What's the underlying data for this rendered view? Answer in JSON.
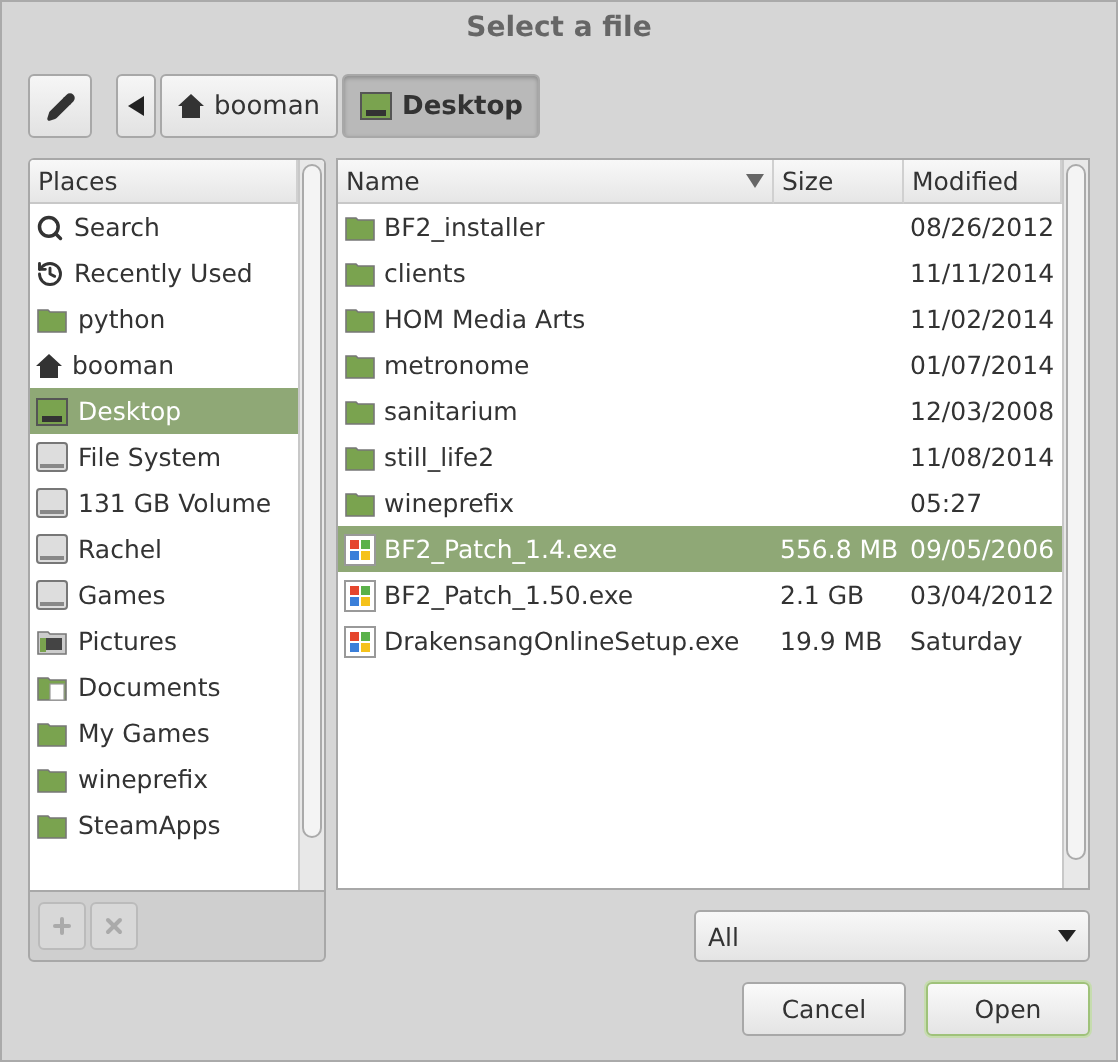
{
  "window": {
    "title": "Select a file"
  },
  "path_bar": {
    "buttons": [
      {
        "label": "booman",
        "kind": "home",
        "selected": false
      },
      {
        "label": "Desktop",
        "kind": "desktop",
        "selected": true
      }
    ]
  },
  "places": {
    "heading": "Places",
    "items": [
      {
        "label": "Search",
        "kind": "search",
        "selected": false
      },
      {
        "label": "Recently Used",
        "kind": "recent",
        "selected": false
      },
      {
        "label": "python",
        "kind": "folder",
        "selected": false
      },
      {
        "label": "booman",
        "kind": "home",
        "selected": false
      },
      {
        "label": "Desktop",
        "kind": "desktop",
        "selected": true
      },
      {
        "label": "File System",
        "kind": "drive",
        "selected": false
      },
      {
        "label": "131 GB Volume",
        "kind": "drive",
        "selected": false
      },
      {
        "label": "Rachel",
        "kind": "drive",
        "selected": false
      },
      {
        "label": "Games",
        "kind": "drive",
        "selected": false
      },
      {
        "label": "Pictures",
        "kind": "pictures",
        "selected": false
      },
      {
        "label": "Documents",
        "kind": "documents",
        "selected": false
      },
      {
        "label": "My Games",
        "kind": "folder",
        "selected": false
      },
      {
        "label": "wineprefix",
        "kind": "folder",
        "selected": false
      },
      {
        "label": "SteamApps",
        "kind": "folder",
        "selected": false
      }
    ]
  },
  "files": {
    "columns": [
      {
        "label": "Name",
        "sorted": true
      },
      {
        "label": "Size",
        "sorted": false
      },
      {
        "label": "Modified",
        "sorted": false
      }
    ],
    "rows": [
      {
        "name": "BF2_installer",
        "size": "",
        "modified": "08/26/2012",
        "kind": "folder",
        "selected": false
      },
      {
        "name": "clients",
        "size": "",
        "modified": "11/11/2014",
        "kind": "folder",
        "selected": false
      },
      {
        "name": "HOM Media Arts",
        "size": "",
        "modified": "11/02/2014",
        "kind": "folder",
        "selected": false
      },
      {
        "name": "metronome",
        "size": "",
        "modified": "01/07/2014",
        "kind": "folder",
        "selected": false
      },
      {
        "name": "sanitarium",
        "size": "",
        "modified": "12/03/2008",
        "kind": "folder",
        "selected": false
      },
      {
        "name": "still_life2",
        "size": "",
        "modified": "11/08/2014",
        "kind": "folder",
        "selected": false
      },
      {
        "name": "wineprefix",
        "size": "",
        "modified": "05:27",
        "kind": "folder",
        "selected": false
      },
      {
        "name": "BF2_Patch_1.4.exe",
        "size": "556.8 MB",
        "modified": "09/05/2006",
        "kind": "exe",
        "selected": true
      },
      {
        "name": "BF2_Patch_1.50.exe",
        "size": "2.1 GB",
        "modified": "03/04/2012",
        "kind": "exe",
        "selected": false
      },
      {
        "name": "DrakensangOnlineSetup.exe",
        "size": "19.9 MB",
        "modified": "Saturday",
        "kind": "exe",
        "selected": false
      }
    ]
  },
  "filter": {
    "value": "All"
  },
  "buttons": [
    {
      "label": "Cancel",
      "default": false
    },
    {
      "label": "Open",
      "default": true
    }
  ]
}
